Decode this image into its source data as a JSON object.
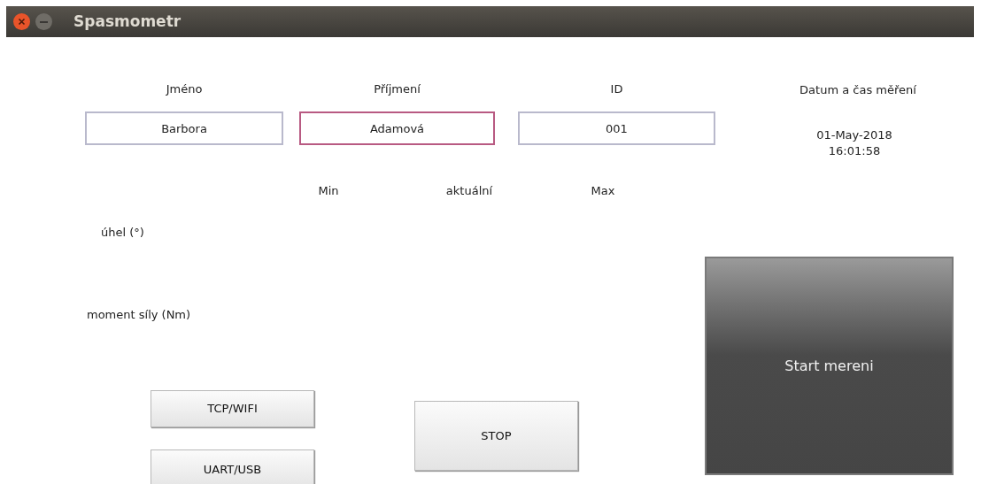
{
  "window": {
    "title": "Spasmometr"
  },
  "fields": [
    {
      "label": "Jméno",
      "value": "Barbora",
      "focused": false
    },
    {
      "label": "Příjmení",
      "value": "Adamová",
      "focused": true
    },
    {
      "label": "ID",
      "value": "001",
      "focused": false
    }
  ],
  "datetime": {
    "label": "Datum a čas měření",
    "date": "01-May-2018",
    "time": "16:01:58"
  },
  "columns": [
    "Min",
    "aktuální",
    "Max"
  ],
  "rows": [
    "úhel (°)",
    "moment síly (Nm)"
  ],
  "buttons": [
    {
      "kind": "connection",
      "label": "TCP/WIFI"
    },
    {
      "kind": "connection",
      "label": "UART/USB"
    },
    {
      "kind": "stop",
      "label": "STOP"
    },
    {
      "kind": "start",
      "label": "Start mereni"
    }
  ]
}
